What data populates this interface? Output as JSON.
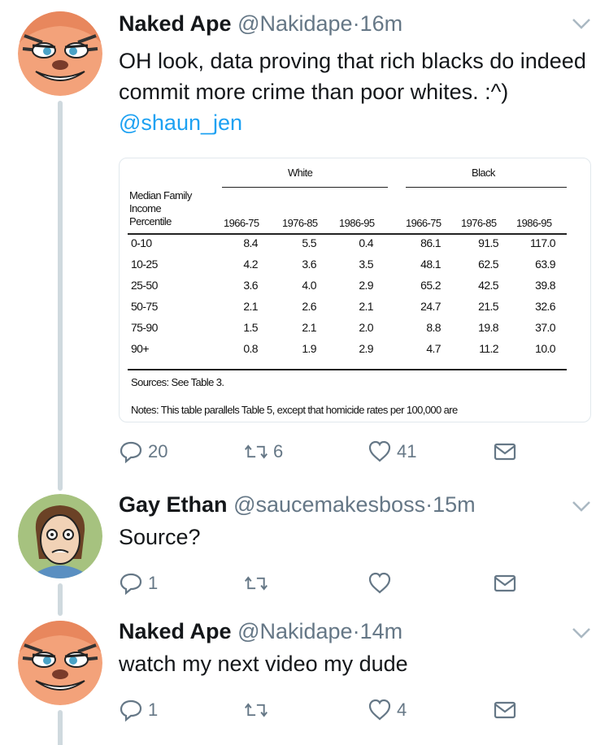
{
  "tweets": [
    {
      "name": "Naked Ape",
      "handle": "@Nakidape",
      "time": "16m",
      "text_plain": "OH look, data proving that rich blacks do indeed commit more crime than poor whites. :^)",
      "mention": "@shaun_jen",
      "replies": "20",
      "retweets": "6",
      "likes": "41"
    },
    {
      "name": "Gay Ethan",
      "handle": "@saucemakesboss",
      "time": "15m",
      "text": "Source?",
      "replies": "1",
      "retweets": "",
      "likes": ""
    },
    {
      "name": "Naked Ape",
      "handle": "@Nakidape",
      "time": "14m",
      "text": "watch my next video my dude",
      "replies": "1",
      "retweets": "",
      "likes": "4"
    }
  ],
  "separator": "·",
  "table": {
    "group_white": "White",
    "group_black": "Black",
    "rowhead_lines": [
      "Median Family",
      "Income",
      "Percentile"
    ],
    "periods": [
      "1966-75",
      "1976-85",
      "1986-95",
      "1966-75",
      "1976-85",
      "1986-95"
    ],
    "rows": [
      {
        "label": "0-10",
        "values": [
          "8.4",
          "5.5",
          "0.4",
          "86.1",
          "91.5",
          "117.0"
        ]
      },
      {
        "label": "10-25",
        "values": [
          "4.2",
          "3.6",
          "3.5",
          "48.1",
          "62.5",
          "63.9"
        ]
      },
      {
        "label": "25-50",
        "values": [
          "3.6",
          "4.0",
          "2.9",
          "65.2",
          "42.5",
          "39.8"
        ]
      },
      {
        "label": "50-75",
        "values": [
          "2.1",
          "2.6",
          "2.1",
          "24.7",
          "21.5",
          "32.6"
        ]
      },
      {
        "label": "75-90",
        "values": [
          "1.5",
          "2.1",
          "2.0",
          "8.8",
          "19.8",
          "37.0"
        ]
      },
      {
        "label": "90+",
        "values": [
          "0.8",
          "1.9",
          "2.9",
          "4.7",
          "11.2",
          "10.0"
        ]
      }
    ],
    "sources": "Sources: See Table 3.",
    "notes": "Notes: This table parallels Table 5, except that homicide rates per 100,000 are"
  },
  "icons": [
    "avatar-tiger",
    "avatar-cartoon-man",
    "caret-down-icon",
    "reply-icon",
    "retweet-icon",
    "like-icon",
    "message-icon"
  ],
  "colors": {
    "link": "#1da1f2",
    "muted": "#657786",
    "thread": "#cfd9de"
  }
}
